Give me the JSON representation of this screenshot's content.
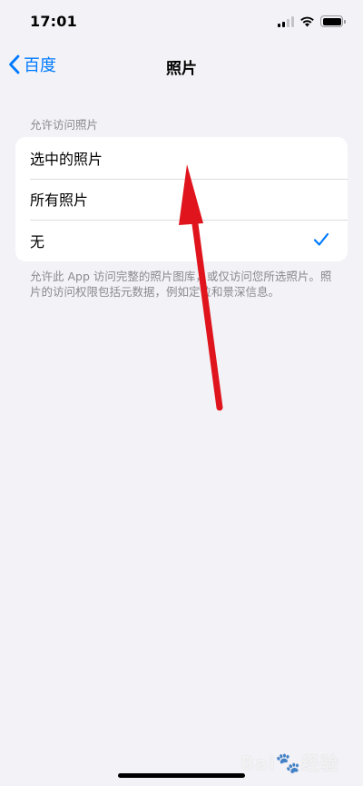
{
  "status_bar": {
    "time": "17:01"
  },
  "nav": {
    "back_label": "百度",
    "title": "照片"
  },
  "section": {
    "header": "允许访问照片",
    "options": [
      {
        "label": "选中的照片",
        "selected": false
      },
      {
        "label": "所有照片",
        "selected": false
      },
      {
        "label": "无",
        "selected": true
      }
    ],
    "footer": "允许此 App 访问完整的照片图库，或仅访问您所选照片。照片的访问权限包括元数据，例如定位和景深信息。"
  },
  "colors": {
    "accent": "#007aff",
    "background": "#f2f2f7",
    "arrow": "#e0141c"
  },
  "watermark": "Baidu经验"
}
